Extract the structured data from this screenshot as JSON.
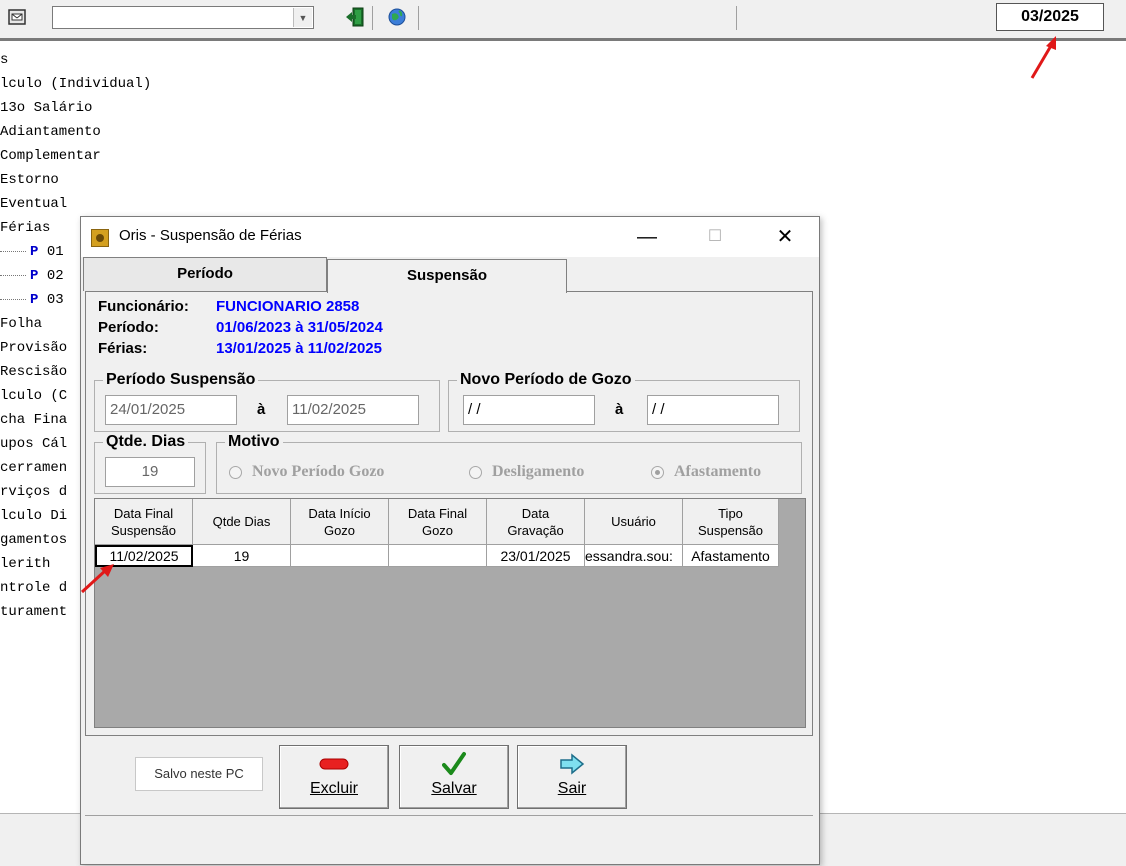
{
  "toolbar": {
    "combo_value": "",
    "competencia": "03/2025",
    "icons": [
      "envelope-icon",
      "exit-door-icon",
      "globe-icon"
    ]
  },
  "tree": {
    "items": [
      "s",
      "lculo (Individual)",
      " 13o Salário",
      " Adiantamento",
      " Complementar",
      " Estorno",
      " Eventual",
      " Férias",
      " Folha",
      " Provisão",
      " Rescisão",
      "lculo (C",
      "cha Fina",
      "upos Cál",
      "cerramen",
      "rviços d",
      "lculo Di",
      "gamentos",
      "lerith",
      "ntrole d",
      "turament"
    ],
    "sub_items": [
      {
        "badge": "P",
        "text": "01"
      },
      {
        "badge": "P",
        "text": "02"
      },
      {
        "badge": "P",
        "text": "03"
      }
    ]
  },
  "dialog": {
    "title": "Oris - Suspensão de Férias",
    "controls": {
      "minimize": "—",
      "maximize": "☐",
      "close": "✕"
    },
    "tabs": [
      "Período",
      "Suspensão"
    ],
    "info": {
      "funcionario_label": "Funcionário:",
      "funcionario_value": "FUNCIONARIO 2858",
      "periodo_label": "Período:",
      "periodo_value": "01/06/2023 à 31/05/2024",
      "ferias_label": "Férias:",
      "ferias_value": "13/01/2025 à 11/02/2025"
    },
    "periodo_suspensao": {
      "title": "Período Suspensão",
      "from": "24/01/2025",
      "to_label": "à",
      "to": "11/02/2025"
    },
    "novo_periodo": {
      "title": "Novo Período de Gozo",
      "from": " / /",
      "to_label": "à",
      "to": " / /"
    },
    "qtde_dias": {
      "title": "Qtde. Dias",
      "value": "19"
    },
    "motivo": {
      "title": "Motivo",
      "options": [
        {
          "label": "Novo Período Gozo",
          "checked": false
        },
        {
          "label": "Desligamento",
          "checked": false
        },
        {
          "label": "Afastamento",
          "checked": true
        }
      ]
    },
    "grid": {
      "columns": [
        "Data Final\nSuspensão",
        "Qtde Dias",
        "Data Início\nGozo",
        "Data Final\nGozo",
        "Data\nGravação",
        "Usuário",
        "Tipo\nSuspensão"
      ],
      "rows": [
        [
          "11/02/2025",
          "19",
          "",
          "",
          "23/01/2025",
          "essandra.sou:",
          "Afastamento"
        ]
      ]
    },
    "saved_label": "Salvo neste PC",
    "buttons": {
      "excluir": "Excluir",
      "salvar": "Salvar",
      "sair": "Sair"
    }
  }
}
